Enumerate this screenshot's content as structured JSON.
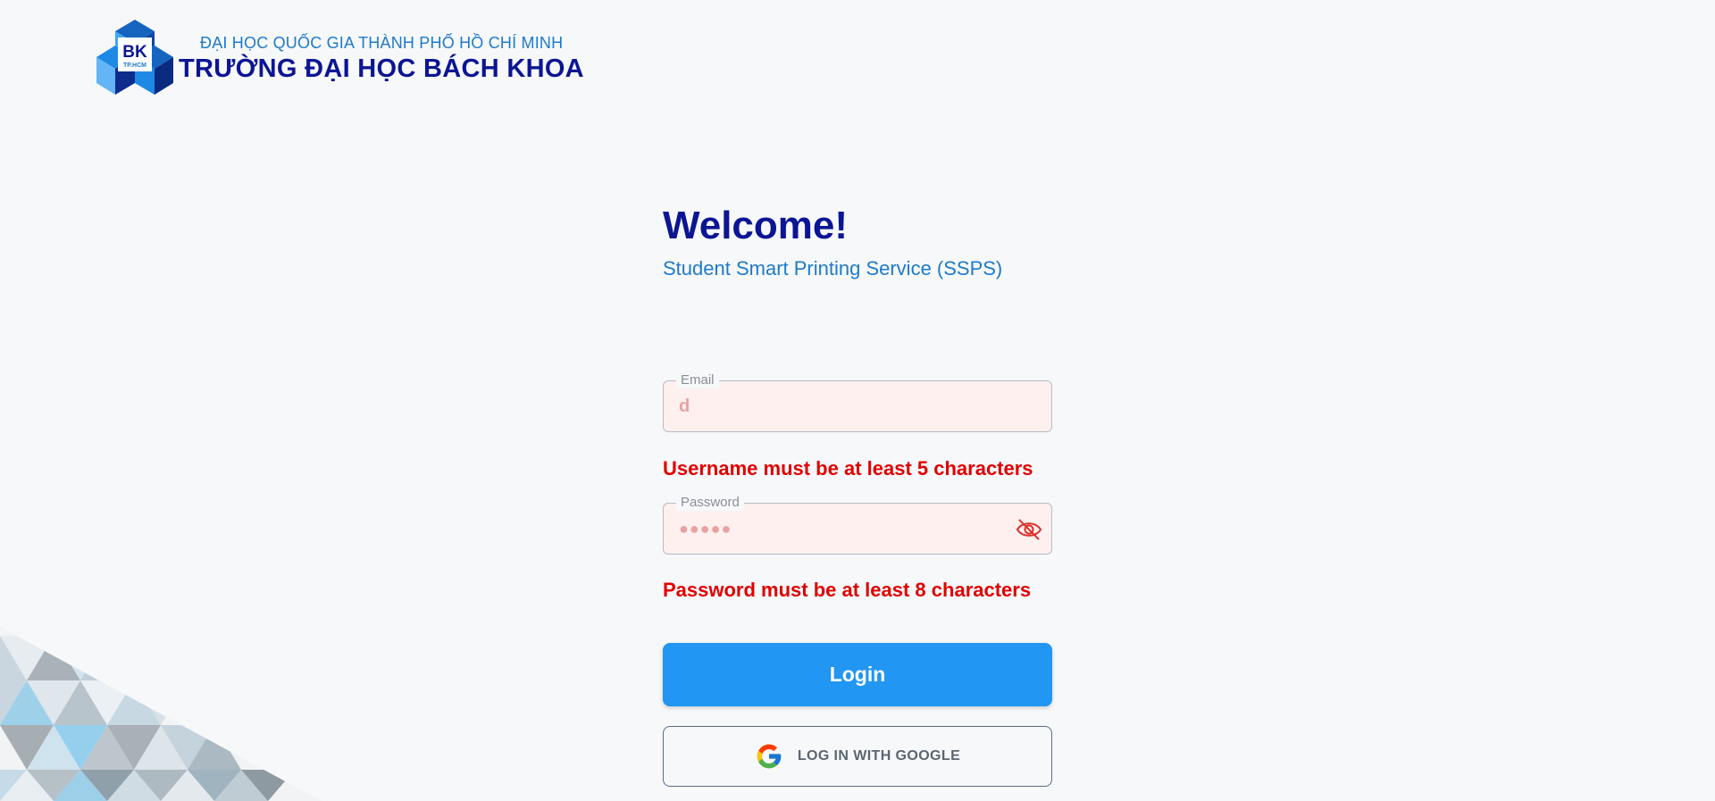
{
  "header": {
    "logo_text": "BK",
    "logo_subtext": "TP.HCM",
    "university_name": "ĐẠI HỌC QUỐC GIA THÀNH PHỐ HỒ CHÍ MINH",
    "school_name": "TRƯỜNG ĐẠI HỌC BÁCH KHOA"
  },
  "login": {
    "title": "Welcome!",
    "subtitle": "Student Smart Printing Service (SSPS)",
    "email": {
      "label": "Email",
      "value": "d",
      "error": "Username must be at least 5 characters"
    },
    "password": {
      "label": "Password",
      "masked_value": "●●●●●",
      "toggle_icon": "eye-off-icon",
      "error": "Password must be at least 8 characters"
    },
    "login_button": "Login",
    "google_button": "LOG IN WITH GOOGLE"
  },
  "colors": {
    "brand_navy": "#0c1593",
    "brand_blue": "#1f7ac9",
    "primary_button": "#2196f3",
    "error": "#e00000",
    "field_error_bg": "#fdf0ef"
  }
}
